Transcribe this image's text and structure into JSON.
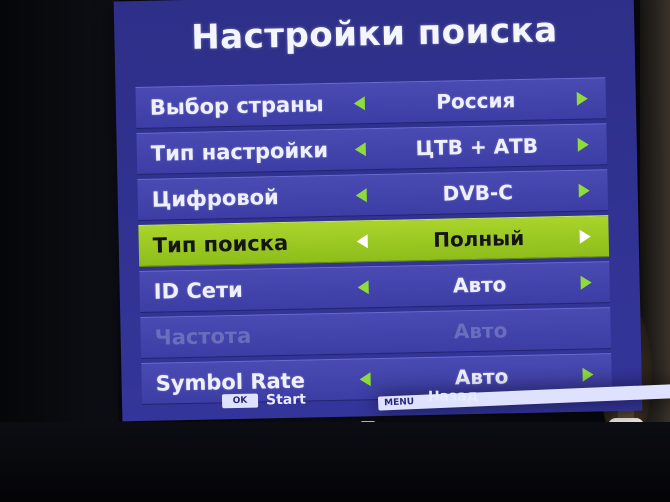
{
  "menu": {
    "title": "Настройки поиска",
    "rows": [
      {
        "label": "Выбор страны",
        "value": "Россия",
        "state": "normal"
      },
      {
        "label": "Тип настройки",
        "value": "ЦТВ + АТВ",
        "state": "normal"
      },
      {
        "label": "Цифровой",
        "value": "DVB-C",
        "state": "normal"
      },
      {
        "label": "Тип поиска",
        "value": "Полный",
        "state": "selected"
      },
      {
        "label": "ID Сети",
        "value": "Авто",
        "state": "normal"
      },
      {
        "label": "Частота",
        "value": "Авто",
        "state": "disabled"
      },
      {
        "label": "Symbol Rate",
        "value": "Авто",
        "state": "normal"
      }
    ]
  },
  "footer": {
    "ok_key": "OK",
    "ok_action": "Start",
    "menu_key": "MENU",
    "menu_action": "Назад"
  },
  "icons": {
    "row_left": "arrow-left-icon",
    "row_right": "arrow-right-icon",
    "scroll": "scroll-down-icon"
  },
  "colors": {
    "panel": "#34359a",
    "row": "#4a4bb2",
    "selected_row": "#a9d42c",
    "arrow": "#8edc3a",
    "text": "#eef0ff"
  }
}
